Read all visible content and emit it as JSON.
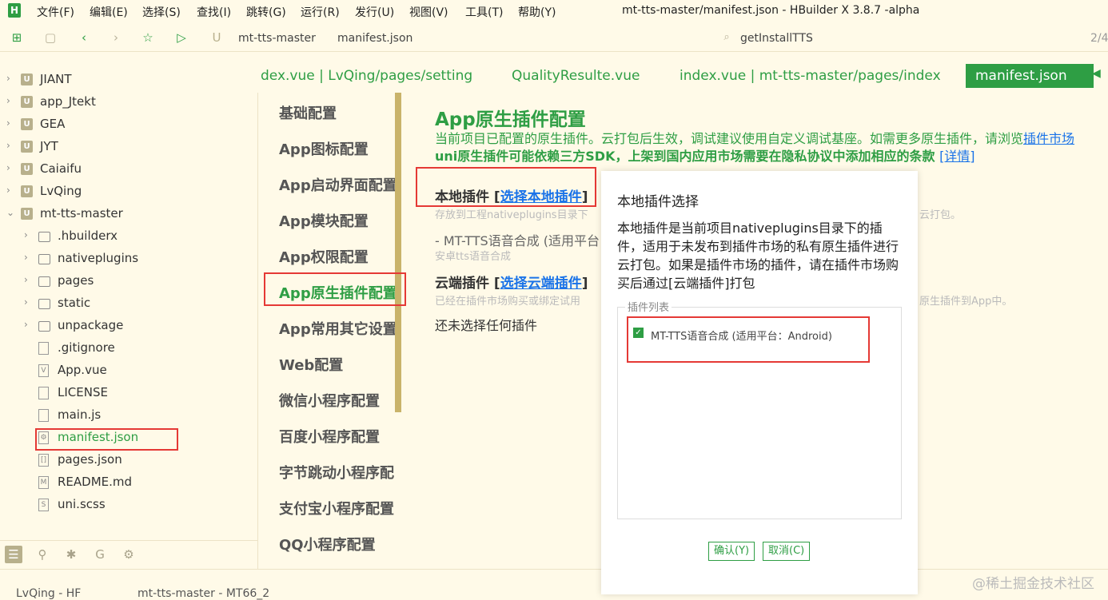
{
  "menu": {
    "items": [
      "文件(F)",
      "编辑(E)",
      "选择(S)",
      "查找(I)",
      "跳转(G)",
      "运行(R)",
      "发行(U)",
      "视图(V)",
      "工具(T)",
      "帮助(Y)"
    ],
    "window_title": "mt-tts-master/manifest.json - HBuilder X 3.8.7 -alpha"
  },
  "toolbar": {
    "crumb_project": "mt-tts-master",
    "crumb_file": "manifest.json",
    "search_text": "getInstallTTS",
    "page_indicator": "2/4"
  },
  "sidebar": {
    "items": [
      {
        "label": "JIANT",
        "kind": "proj",
        "arrow": "›"
      },
      {
        "label": "app_Jtekt",
        "kind": "proj",
        "arrow": "›"
      },
      {
        "label": "GEA",
        "kind": "proj",
        "arrow": "›"
      },
      {
        "label": "JYT",
        "kind": "proj",
        "arrow": "›"
      },
      {
        "label": "Caiaifu",
        "kind": "proj",
        "arrow": "›"
      },
      {
        "label": "LvQing",
        "kind": "proj",
        "arrow": "›"
      },
      {
        "label": "mt-tts-master",
        "kind": "proj",
        "arrow": "⌄"
      },
      {
        "label": ".hbuilderx",
        "kind": "folder",
        "arrow": "›"
      },
      {
        "label": "nativeplugins",
        "kind": "folder",
        "arrow": "›"
      },
      {
        "label": "pages",
        "kind": "folder",
        "arrow": "›"
      },
      {
        "label": "static",
        "kind": "folder",
        "arrow": "›"
      },
      {
        "label": "unpackage",
        "kind": "folder",
        "arrow": "›"
      },
      {
        "label": ".gitignore",
        "kind": "file",
        "arrow": ""
      },
      {
        "label": "App.vue",
        "kind": "file",
        "arrow": ""
      },
      {
        "label": "LICENSE",
        "kind": "file",
        "arrow": ""
      },
      {
        "label": "main.js",
        "kind": "file",
        "arrow": ""
      },
      {
        "label": "manifest.json",
        "kind": "file",
        "arrow": ""
      },
      {
        "label": "pages.json",
        "kind": "file",
        "arrow": ""
      },
      {
        "label": "README.md",
        "kind": "file",
        "arrow": ""
      },
      {
        "label": "uni.scss",
        "kind": "file",
        "arrow": ""
      }
    ],
    "selected": "manifest.json"
  },
  "status": {
    "left": "LvQing - HF",
    "middle": "mt-tts-master - MT66_2"
  },
  "tabs": [
    {
      "label": "dex.vue | LvQing/pages/setting",
      "active": false
    },
    {
      "label": "QualityResulte.vue",
      "active": false
    },
    {
      "label": "index.vue | mt-tts-master/pages/index",
      "active": false
    },
    {
      "label": "manifest.json",
      "active": true
    }
  ],
  "settings_nav": {
    "items": [
      "基础配置",
      "App图标配置",
      "App启动界面配置",
      "App模块配置",
      "App权限配置",
      "App原生插件配置",
      "App常用其它设置",
      "Web配置",
      "微信小程序配置",
      "百度小程序配置",
      "字节跳动小程序配",
      "支付宝小程序配置",
      "QQ小程序配置"
    ],
    "active": "App原生插件配置"
  },
  "content": {
    "title": "App原生插件配置",
    "desc": "当前项目已配置的原生插件。云打包后生效，调试建议使用自定义调试基座。如需更多原生插件，请浏览",
    "desc_link": "插件市场",
    "warn": "uni原生插件可能依赖三方SDK，上架到国内应用市场需要在隐私协议中添加相应的条款",
    "warn_link": "[详情]",
    "local_head": "本地插件",
    "local_link": "选择本地插件",
    "local_sub": "存放到工程nativeplugins目录下",
    "local_sub_tail": "云打包。",
    "local_plugin": "- MT-TTS语音合成 (适用平台",
    "local_plugin_sub": "安卓tts语音合成",
    "cloud_head": "云端插件",
    "cloud_link": "选择云端插件",
    "cloud_sub": "已经在插件市场购买或绑定试用",
    "cloud_sub_tail": "原生插件到App中。",
    "none_selected": "还未选择任何插件"
  },
  "dialog": {
    "title": "本地插件选择",
    "description": "本地插件是当前项目nativeplugins目录下的插件，适用于未发布到插件市场的私有原生插件进行云打包。如果是插件市场的插件，请在插件市场购买后通过[云端插件]打包",
    "list_legend": "插件列表",
    "plugin_label": "MT-TTS语音合成 (适用平台：Android)",
    "plugin_checked": true,
    "confirm_label": "确认(Y)",
    "cancel_label": "取消(C)"
  },
  "watermark": "@稀土掘金技术社区",
  "colors": {
    "accent": "#2e9e44",
    "background": "#fffae8",
    "link": "#1a73e8",
    "highlight": "#e53935"
  }
}
